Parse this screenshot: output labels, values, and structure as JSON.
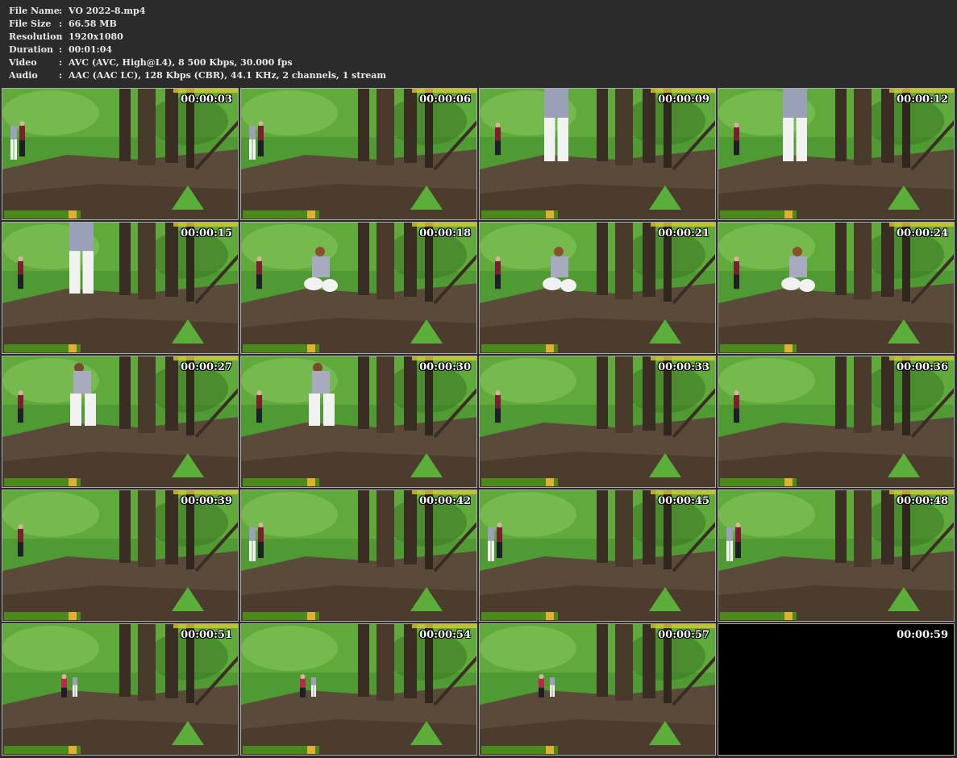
{
  "file_info": [
    {
      "label": "File Name",
      "sep": ":",
      "value": "VO 2022-8.mp4"
    },
    {
      "label": "File Size",
      "sep": ":",
      "value": "66.58 MB"
    },
    {
      "label": "Resolution",
      "sep": ":",
      "value": "1920x1080"
    },
    {
      "label": "Duration",
      "sep": ":",
      "value": "00:01:04"
    },
    {
      "label": "Video",
      "sep": ":",
      "value": "AVC (AVC, High@L4), 8 500 Kbps, 30.000 fps"
    },
    {
      "label": "Audio",
      "sep": ":",
      "value": "AAC (AAC LC), 128 Kbps (CBR), 44.1 KHz, 2 channels, 1 stream"
    }
  ],
  "frames": [
    {
      "timestamp": "00:00:03",
      "scene": "two-people-left"
    },
    {
      "timestamp": "00:00:06",
      "scene": "two-people-left"
    },
    {
      "timestamp": "00:00:09",
      "scene": "standing-back"
    },
    {
      "timestamp": "00:00:12",
      "scene": "standing-back"
    },
    {
      "timestamp": "00:00:15",
      "scene": "standing-back-left"
    },
    {
      "timestamp": "00:00:18",
      "scene": "squatting"
    },
    {
      "timestamp": "00:00:21",
      "scene": "squatting"
    },
    {
      "timestamp": "00:00:24",
      "scene": "squatting"
    },
    {
      "timestamp": "00:00:27",
      "scene": "rising"
    },
    {
      "timestamp": "00:00:30",
      "scene": "rising"
    },
    {
      "timestamp": "00:00:33",
      "scene": "empty"
    },
    {
      "timestamp": "00:00:36",
      "scene": "empty"
    },
    {
      "timestamp": "00:00:39",
      "scene": "empty"
    },
    {
      "timestamp": "00:00:42",
      "scene": "two-people-left"
    },
    {
      "timestamp": "00:00:45",
      "scene": "two-people-left"
    },
    {
      "timestamp": "00:00:48",
      "scene": "two-people-left"
    },
    {
      "timestamp": "00:00:51",
      "scene": "walking-away"
    },
    {
      "timestamp": "00:00:54",
      "scene": "walking-away"
    },
    {
      "timestamp": "00:00:57",
      "scene": "walking-away"
    },
    {
      "timestamp": "00:00:59",
      "scene": "black"
    }
  ],
  "colors": {
    "background": "#2b2b2b",
    "foliage": "#4f9a32",
    "ground": "#5a4a3a",
    "overlay_banner": "#4a8a1a",
    "overlay_banner_text": "#e8d23a"
  }
}
